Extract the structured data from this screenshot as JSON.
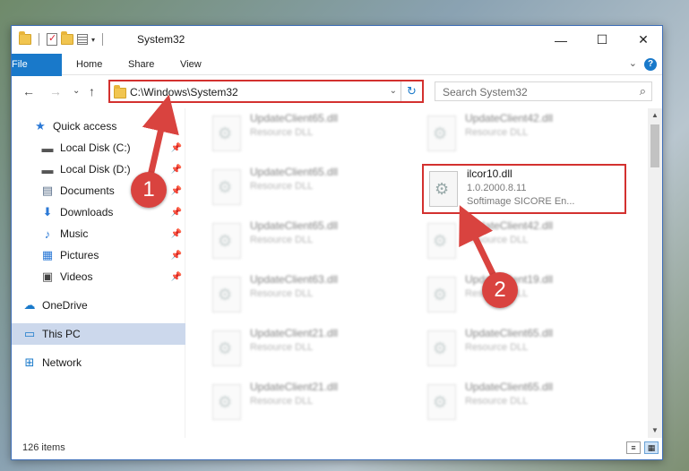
{
  "window": {
    "title": "System32",
    "controls": {
      "minimize": "—",
      "maximize": "☐",
      "close": "✕"
    }
  },
  "ribbon": {
    "tabs": [
      "File",
      "Home",
      "Share",
      "View"
    ],
    "help": "?"
  },
  "navbar": {
    "back": "←",
    "forward": "→",
    "recent": "⌄",
    "up": "↑",
    "address": "C:\\Windows\\System32",
    "refresh": "↻",
    "search_placeholder": "Search System32",
    "search_icon": "⌕"
  },
  "sidebar": {
    "items": [
      {
        "label": "Quick access",
        "icon": "star-icon",
        "glyph": "★",
        "color": "#2b79d6"
      },
      {
        "label": "Local Disk (C:)",
        "icon": "drive-icon",
        "glyph": "▬",
        "color": "#555555",
        "pin": true
      },
      {
        "label": "Local Disk (D:)",
        "icon": "drive-icon",
        "glyph": "▬",
        "color": "#555555",
        "pin": true
      },
      {
        "label": "Documents",
        "icon": "documents-icon",
        "glyph": "▤",
        "color": "#5a6f8a",
        "pin": true
      },
      {
        "label": "Downloads",
        "icon": "downloads-icon",
        "glyph": "⬇",
        "color": "#2b79d6",
        "pin": true
      },
      {
        "label": "Music",
        "icon": "music-icon",
        "glyph": "♪",
        "color": "#2b79d6",
        "pin": true
      },
      {
        "label": "Pictures",
        "icon": "pictures-icon",
        "glyph": "▦",
        "color": "#2b79d6",
        "pin": true
      },
      {
        "label": "Videos",
        "icon": "videos-icon",
        "glyph": "▣",
        "color": "#444444",
        "pin": true
      },
      {
        "label": "OneDrive",
        "icon": "onedrive-icon",
        "glyph": "☁",
        "color": "#1979ca"
      },
      {
        "label": "This PC",
        "icon": "pc-icon",
        "glyph": "▭",
        "color": "#1979ca",
        "selected": true
      },
      {
        "label": "Network",
        "icon": "network-icon",
        "glyph": "⊞",
        "color": "#1979ca"
      }
    ]
  },
  "files": {
    "left_column": [
      {
        "name": "UpdateClient65.dll",
        "type": "Resource DLL"
      },
      {
        "name": "UpdateClient65.dll",
        "type": "Resource DLL"
      },
      {
        "name": "UpdateClient65.dll",
        "type": "Resource DLL"
      },
      {
        "name": "UpdateClient63.dll",
        "type": "Resource DLL"
      },
      {
        "name": "UpdateClient21.dll",
        "type": "Resource DLL"
      },
      {
        "name": "UpdateClient21.dll",
        "type": "Resource DLL"
      }
    ],
    "right_column": [
      {
        "name": "UpdateClient42.dll",
        "type": "Resource DLL"
      },
      {
        "name": "ilcor10.dll",
        "version": "1.0.2000.8.11",
        "type": "Softimage SICORE En...",
        "highlighted": true
      },
      {
        "name": "UpdateClient42.dll",
        "type": "Resource DLL"
      },
      {
        "name": "UpdateClient19.dll",
        "type": "Resource DLL"
      },
      {
        "name": "UpdateClient65.dll",
        "type": "Resource DLL"
      },
      {
        "name": "UpdateClient65.dll",
        "type": "Resource DLL"
      }
    ]
  },
  "status": {
    "count": "126 items"
  },
  "annotations": {
    "badge1": "1",
    "badge2": "2",
    "color": "#d9433f"
  }
}
